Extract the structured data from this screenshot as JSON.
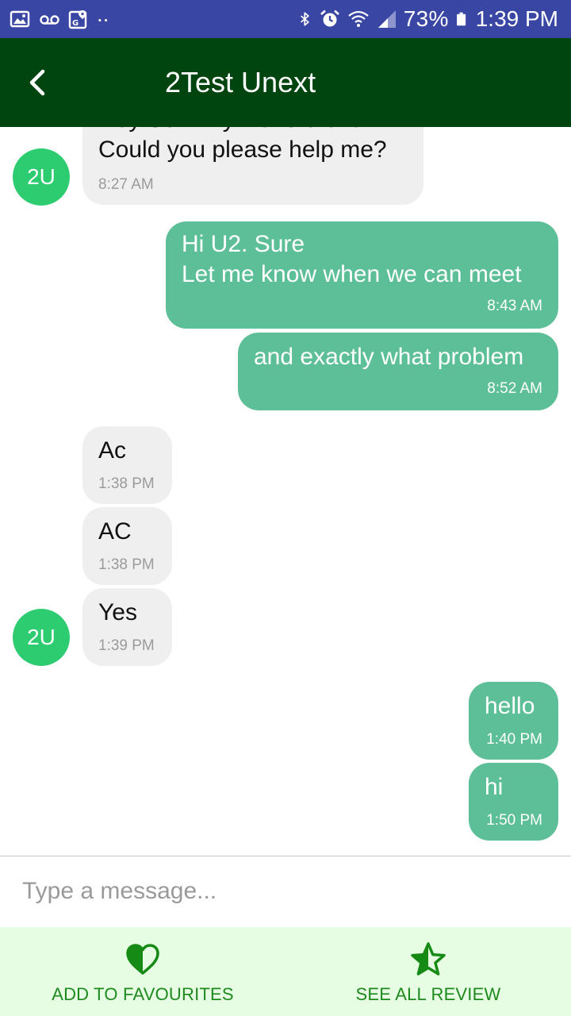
{
  "status_bar": {
    "battery": "73%",
    "time": "1:39 PM",
    "icons": [
      "image-icon",
      "voicemail-icon",
      "maps-icon",
      "more-dots-icon",
      "bluetooth-icon",
      "alarm-icon",
      "wifi-icon",
      "signal-icon",
      "battery-icon"
    ]
  },
  "header": {
    "title": "2Test Unext",
    "back_icon": "chevron-left-icon"
  },
  "messages": [
    {
      "direction": "incoming",
      "text": "Hey Son. My AC is broken.\nCould you please help me?",
      "time": "8:27 AM",
      "avatar": "2U"
    },
    {
      "direction": "outgoing",
      "text": "Hi U2. Sure\nLet me know when we can meet",
      "time": "8:43 AM"
    },
    {
      "direction": "outgoing",
      "text": "and exactly what problem",
      "time": "8:52 AM"
    },
    {
      "direction": "incoming",
      "text": "Ac",
      "time": "1:38 PM"
    },
    {
      "direction": "incoming",
      "text": "AC",
      "time": "1:38 PM"
    },
    {
      "direction": "incoming",
      "text": "Yes",
      "time": "1:39 PM",
      "avatar": "2U"
    },
    {
      "direction": "outgoing",
      "text": "hello",
      "time": "1:40 PM"
    },
    {
      "direction": "outgoing",
      "text": "hi",
      "time": "1:50 PM"
    }
  ],
  "composer": {
    "placeholder": "Type a message...",
    "value": ""
  },
  "actions": {
    "favourites": {
      "label": "ADD TO FAVOURITES",
      "icon": "heart-icon"
    },
    "reviews": {
      "label": "SEE ALL REVIEW",
      "icon": "star-icon"
    }
  },
  "colors": {
    "status_bar": "#3a46a3",
    "app_bar": "#00450f",
    "outgoing_bubble": "#5dbf98",
    "incoming_bubble": "#efefef",
    "avatar": "#2ecc71",
    "action_bar": "#e6fde3",
    "action_text": "#1e8a1e"
  }
}
